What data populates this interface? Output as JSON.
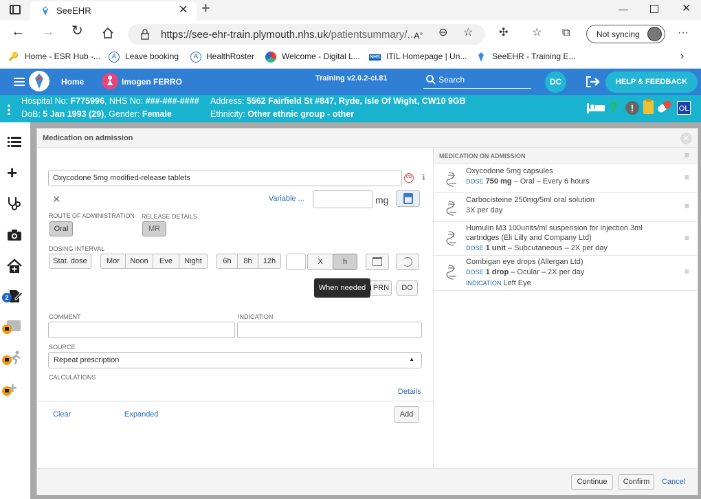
{
  "browser": {
    "tab_title": "SeeEHR",
    "url_host": "https://see-ehr-train.plymouth.nhs.uk",
    "url_path": "/patientsummary/...",
    "sync_label": "Not syncing",
    "bookmarks": [
      "Home - ESR Hub -...",
      "Leave booking",
      "HealthRoster",
      "Welcome - Digital L...",
      "ITIL Homepage | Un...",
      "SeeEHR - Training E..."
    ]
  },
  "app": {
    "home": "Home",
    "patient_name": "Imogen FERRO",
    "version": "Training v2.0.2-ci.81",
    "search_label": "Search",
    "user_initials": "DC",
    "help_label": "HELP & FEEDBACK",
    "ol_badge": "OL",
    "notification_count": "2"
  },
  "patient": {
    "hospital_no_label": "Hospital No:",
    "hospital_no": "F775996",
    "nhs_label": ", NHS No:",
    "nhs_no": "###-###-####",
    "address_label": "Address:",
    "address": "5562 Fairfield St #847, Ryde, Isle Of Wight, CW10 9GB",
    "dob_label": "DoB:",
    "dob": "5 Jan 1993 (29)",
    "gender_label": ", Gender:",
    "gender": "Female",
    "ethnicity_label": "Ethnicity:",
    "ethnicity": "Other ethnic group - other"
  },
  "modal": {
    "title": "Medication on admission",
    "drug_value": "Oxycodone 5mg modified-release tablets",
    "variable_link": "Variable ...",
    "dose_unit": "mg",
    "route_label": "ROUTE OF ADMINISTRATION",
    "route_value": "Oral",
    "release_label": "RELEASE DETAILS",
    "release_value": "MR",
    "dosing_label": "DOSING INTERVAL",
    "stat_dose": "Stat. dose",
    "times": [
      "Mor",
      "Noon",
      "Eve",
      "Night"
    ],
    "hours": [
      "6h",
      "8h",
      "12h"
    ],
    "x_label": "X",
    "h_label": "h",
    "tooltip": "When needed",
    "prn": "PRN",
    "do": "DO",
    "comment_label": "COMMENT",
    "indication_label": "INDICATION",
    "source_label": "SOURCE",
    "source_value": "Repeat prescription",
    "calculations_label": "CALCULATIONS",
    "details_link": "Details",
    "clear_link": "Clear",
    "expanded_link": "Expanded",
    "add_button": "Add",
    "list_header": "MEDICATION ON ADMISSION",
    "continue": "Continue",
    "confirm": "Confirm",
    "cancel": "Cancel"
  },
  "meds": [
    {
      "name": "Oxycodone 5mg capsules",
      "dose_k": "DOSE",
      "dose_v": "750 mg",
      "rest": " – Oral – Every 6 hours"
    },
    {
      "name": "Carbocisteine 250mg/5ml oral solution",
      "line2": "3X per day"
    },
    {
      "name": "Humulin M3 100units/ml suspension for injection 3ml",
      "name2": "cartridges (Eli Lilly and Company Ltd)",
      "dose_k": "DOSE",
      "dose_v": "1 unit",
      "rest": " – Subcutaneous – 2X per day"
    },
    {
      "name": "Combigan eye drops (Allergan Ltd)",
      "dose_k": "DOSE",
      "dose_v": "1 drop",
      "rest": " – Ocular – 2X per day",
      "ind_k": "INDICATION",
      "ind_v": "Left Eye"
    }
  ],
  "colors": {
    "header_blue": "#2f7fd4",
    "info_teal": "#1ab3cf",
    "link": "#2a6db5"
  }
}
